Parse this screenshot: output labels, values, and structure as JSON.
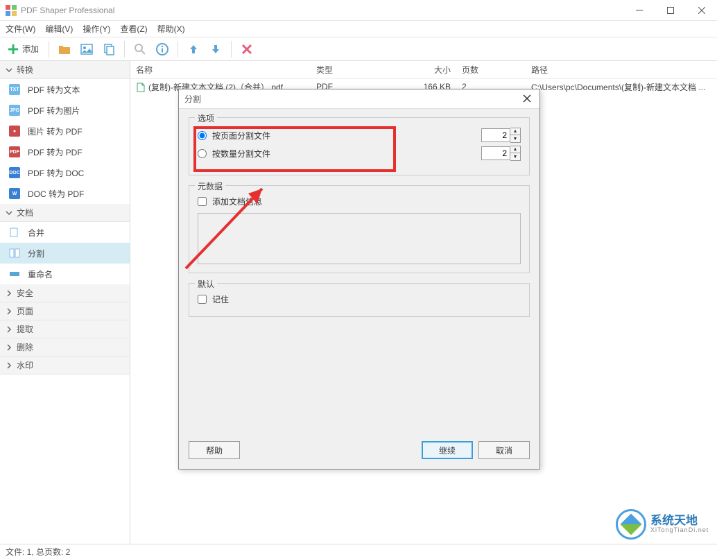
{
  "app": {
    "title": "PDF Shaper Professional"
  },
  "menu": {
    "file": "文件(W)",
    "edit": "编辑(V)",
    "action": "操作(Y)",
    "view": "查看(Z)",
    "help": "帮助(X)"
  },
  "toolbar": {
    "add": "添加"
  },
  "sidebar": {
    "convert_header": "转换",
    "convert": [
      {
        "label": "PDF 转为文本",
        "badge": "TXT",
        "color": "#6fb8e8"
      },
      {
        "label": "PDF 转为图片",
        "badge": "JPG",
        "color": "#6fb8e8"
      },
      {
        "label": "图片 转为 PDF",
        "badge": "●",
        "color": "#c94b4b"
      },
      {
        "label": "PDF 转为 PDF",
        "badge": "PDF",
        "color": "#c94b4b"
      },
      {
        "label": "PDF 转为 DOC",
        "badge": "DOC",
        "color": "#3a7fd6"
      },
      {
        "label": "DOC 转为 PDF",
        "badge": "W",
        "color": "#3a7fd6"
      }
    ],
    "doc_header": "文档",
    "doc": [
      {
        "label": "合并"
      },
      {
        "label": "分割"
      },
      {
        "label": "重命名"
      }
    ],
    "others": [
      "安全",
      "页面",
      "提取",
      "删除",
      "水印"
    ]
  },
  "columns": {
    "name": "名称",
    "type": "类型",
    "size": "大小",
    "pages": "页数",
    "path": "路径"
  },
  "rows": [
    {
      "name": "(复制)-新建文本文档 (2)（合并）.pdf",
      "type": "PDF",
      "size": "166 KB",
      "pages": "2",
      "path": "C:\\Users\\pc\\Documents\\(复制)-新建文本文档 ..."
    }
  ],
  "dialog": {
    "title": "分割",
    "options_legend": "选项",
    "opt_by_page": "按页面分割文件",
    "opt_by_count": "按数量分割文件",
    "val_by_page": "2",
    "val_by_count": "2",
    "meta_legend": "元数据",
    "add_doc_info": "添加文档信息",
    "default_legend": "默认",
    "remember": "记住",
    "help": "帮助",
    "continue": "继续",
    "cancel": "取消"
  },
  "status": "文件: 1, 总页数: 2",
  "watermark": {
    "brand": "系统天地",
    "url": "XiTongTianDi.net"
  }
}
